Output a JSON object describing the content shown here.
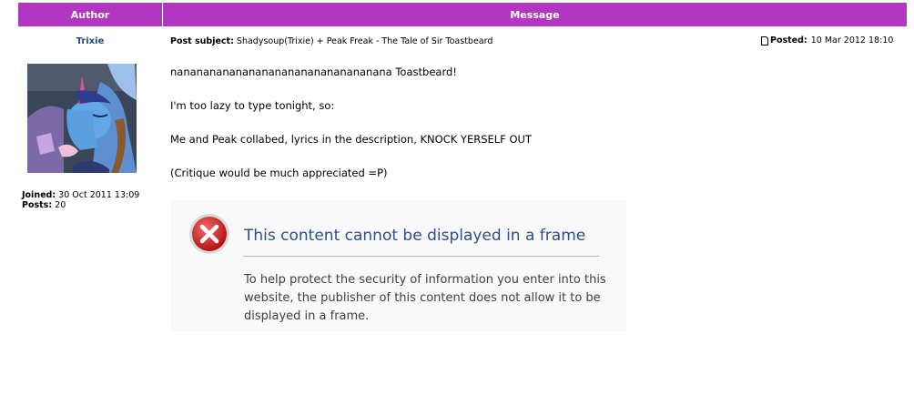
{
  "table": {
    "author_header": "Author",
    "message_header": "Message"
  },
  "author": {
    "name": "Trixie",
    "joined_label": "Joined:",
    "joined_value": "30 Oct 2011 13:09",
    "posts_label": "Posts:",
    "posts_value": "20"
  },
  "post": {
    "subject_label": "Post subject:",
    "subject_value": "Shadysoup(Trixie) + Peak Freak - The Tale of Sir Toastbeard",
    "posted_label": "Posted:",
    "posted_value": "10 Mar 2012 18:10",
    "posted_icon": "document-icon",
    "body": [
      "nanananananananananananananananana Toastbeard!",
      "I'm too lazy to type tonight, so:",
      "Me and Peak collabed, lyrics in the description, KNOCK YERSELF OUT",
      "(Critique would be much appreciated =P)"
    ]
  },
  "frame_error": {
    "icon": "error-x-icon",
    "title": "This content cannot be displayed in a frame",
    "message": "To help protect the security of information you enter into this website, the publisher of this content does not allow it to be displayed in a frame."
  },
  "colors": {
    "header_bg": "#b336c3",
    "author_name": "#1a4e84",
    "error_title": "#2a4f8a",
    "error_red": "#cc1f1f"
  }
}
